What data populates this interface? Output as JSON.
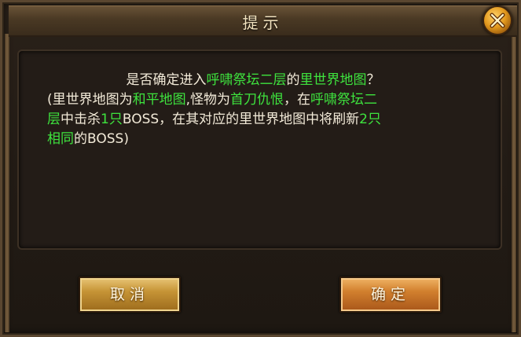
{
  "dialog": {
    "title": "提示",
    "close_icon": "close-x-icon",
    "message": {
      "line1": [
        {
          "text": "是否确定进入",
          "color": "#f2ead8"
        },
        {
          "text": "呼啸祭坛二层",
          "color": "#3ee33e"
        },
        {
          "text": "的",
          "color": "#f2ead8"
        },
        {
          "text": "里世界地图",
          "color": "#3ee33e"
        },
        {
          "text": "？",
          "color": "#f2ead8"
        }
      ],
      "line2": [
        {
          "text": "(里世界地图为",
          "color": "#f2ead8"
        },
        {
          "text": "和平地图",
          "color": "#3ee33e"
        },
        {
          "text": ",怪物为",
          "color": "#f2ead8"
        },
        {
          "text": "首刀仇恨",
          "color": "#3ee33e"
        },
        {
          "text": "，在",
          "color": "#f2ead8"
        },
        {
          "text": "呼啸祭坛二",
          "color": "#3ee33e"
        }
      ],
      "line3": [
        {
          "text": "层",
          "color": "#3ee33e"
        },
        {
          "text": "中击杀",
          "color": "#f2ead8"
        },
        {
          "text": "1只",
          "color": "#3ee33e"
        },
        {
          "text": "BOSS，在其对应的里世界地图中将刷新",
          "color": "#f2ead8"
        },
        {
          "text": "2只",
          "color": "#3ee33e"
        }
      ],
      "line4": [
        {
          "text": "相同",
          "color": "#3ee33e"
        },
        {
          "text": "的BOSS)",
          "color": "#f2ead8"
        }
      ]
    },
    "buttons": {
      "cancel_label": "取消",
      "confirm_label": "确定"
    }
  },
  "colors": {
    "highlight": "#3ee33e",
    "text": "#f2ead8",
    "title": "#f3e3bf"
  }
}
